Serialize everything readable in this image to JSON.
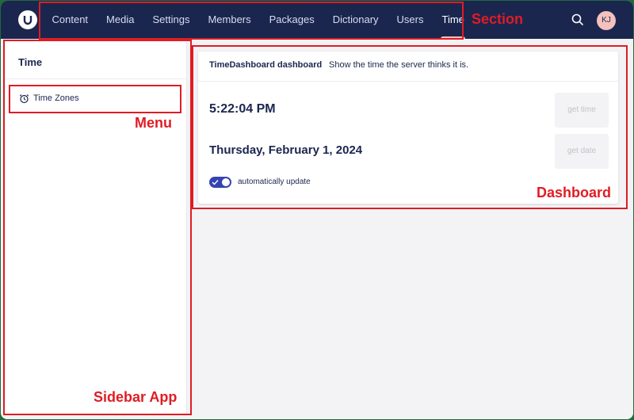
{
  "header": {
    "logo": "umbraco-logo-icon",
    "nav": [
      {
        "label": "Content",
        "active": false
      },
      {
        "label": "Media",
        "active": false
      },
      {
        "label": "Settings",
        "active": false
      },
      {
        "label": "Members",
        "active": false
      },
      {
        "label": "Packages",
        "active": false
      },
      {
        "label": "Dictionary",
        "active": false
      },
      {
        "label": "Users",
        "active": false
      },
      {
        "label": "Time",
        "active": true
      }
    ],
    "search_icon": "search-icon",
    "avatar_initials": "KJ"
  },
  "sidebar": {
    "title": "Time",
    "menu": [
      {
        "label": "Time Zones",
        "icon": "alarm-clock-icon"
      }
    ]
  },
  "dashboard": {
    "title": "TimeDashboard dashboard",
    "description": "Show the time the server thinks it is.",
    "time": "5:22:04 PM",
    "date": "Thursday, February 1, 2024",
    "get_time_label": "get time",
    "get_date_label": "get date",
    "auto_update_label": "automatically update",
    "auto_update": true
  },
  "annotations": {
    "section": "Section",
    "menu": "Menu",
    "dashboard": "Dashboard",
    "sidebar": "Sidebar App"
  },
  "colors": {
    "header_bg": "#1b264f",
    "accent": "#3544b1",
    "highlight": "#e01c24",
    "active_indicator": "#f5c1bc"
  }
}
